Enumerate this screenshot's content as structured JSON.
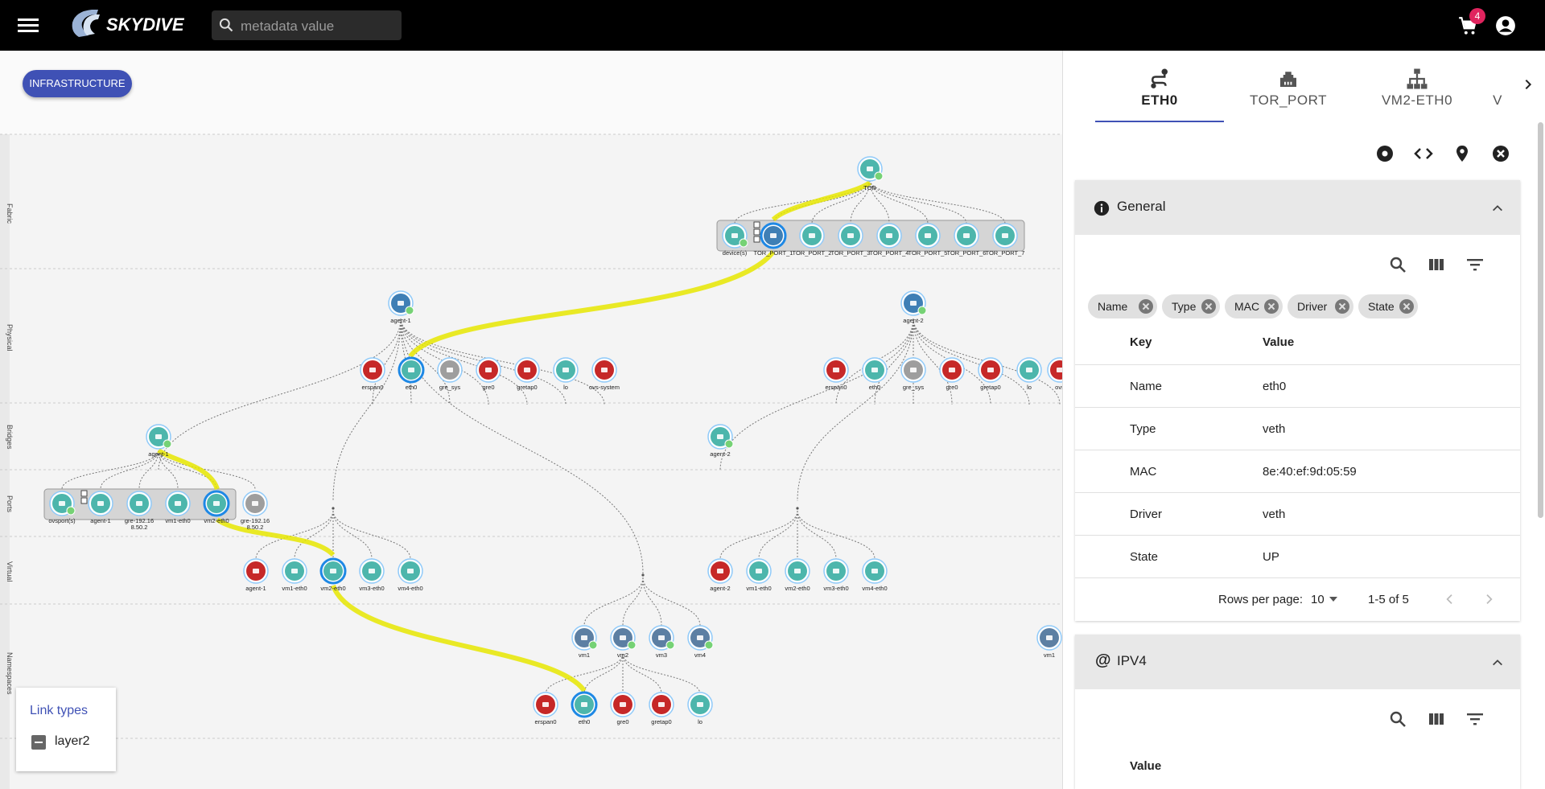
{
  "header": {
    "logo_text": "SKYDIVE",
    "search_placeholder": "metadata value",
    "cart_count": "4"
  },
  "main": {
    "infra_button": "INFRASTRUCTURE",
    "layers": [
      "Fabric",
      "Physical",
      "Bridges",
      "Ports",
      "Virtual",
      "Namespaces"
    ]
  },
  "legend": {
    "title": "Link types",
    "item": "layer2"
  },
  "panel": {
    "tabs": [
      "ETH0",
      "TOR_PORT",
      "VM2-ETH0",
      "V"
    ],
    "general": {
      "title": "General",
      "chips": [
        "Name",
        "Type",
        "MAC",
        "Driver",
        "State"
      ],
      "col_key": "Key",
      "col_value": "Value",
      "rows": [
        {
          "k": "Name",
          "v": "eth0"
        },
        {
          "k": "Type",
          "v": "veth"
        },
        {
          "k": "MAC",
          "v": "8e:40:ef:9d:05:59"
        },
        {
          "k": "Driver",
          "v": "veth"
        },
        {
          "k": "State",
          "v": "UP"
        }
      ],
      "rows_per_page_label": "Rows per page:",
      "rows_per_page": "10",
      "range": "1-5 of 5"
    },
    "ipv4": {
      "title": "IPV4",
      "col_value": "Value"
    }
  },
  "graph": {
    "tor": "TOR",
    "tor_ports": [
      "device(s)",
      "TOR_PORT_1",
      "TOR_PORT_2",
      "TOR_PORT_3",
      "TOR_PORT_4",
      "TOR_PORT_5",
      "TOR_PORT_6",
      "TOR_PORT_7"
    ],
    "agent1": "agent-1",
    "agent1_ifs": [
      "erspan0",
      "eth0",
      "gre_sys",
      "gre0",
      "gretap0",
      "lo",
      "ovs-system"
    ],
    "agent2": "agent-2",
    "agent2_ifs": [
      "erspan0",
      "eth0",
      "gre_sys",
      "gre0",
      "gretap0",
      "lo",
      "ovs"
    ],
    "bridge1": "agent-1",
    "bridge2": "agent-2",
    "ports1": [
      "ovsport(s)",
      "agent-1",
      "gre-192.16",
      "vm1-eth0",
      "vm2-eth0",
      "gre-192.16"
    ],
    "ports1_l2": [
      "",
      "",
      "8.50.2",
      "",
      "",
      "8.50.2"
    ],
    "virt1": [
      "agent-1",
      "vm1-eth0",
      "vm2-eth0",
      "vm3-eth0",
      "vm4-eth0"
    ],
    "virt2": [
      "agent-2",
      "vm1-eth0",
      "vm2-eth0",
      "vm3-eth0",
      "vm4-eth0"
    ],
    "ns": [
      "vm1",
      "vm2",
      "vm3",
      "vm4"
    ],
    "ns_right": "vm1",
    "ns_ifs": [
      "erspan0",
      "eth0",
      "gre0",
      "gretap0",
      "lo"
    ]
  }
}
